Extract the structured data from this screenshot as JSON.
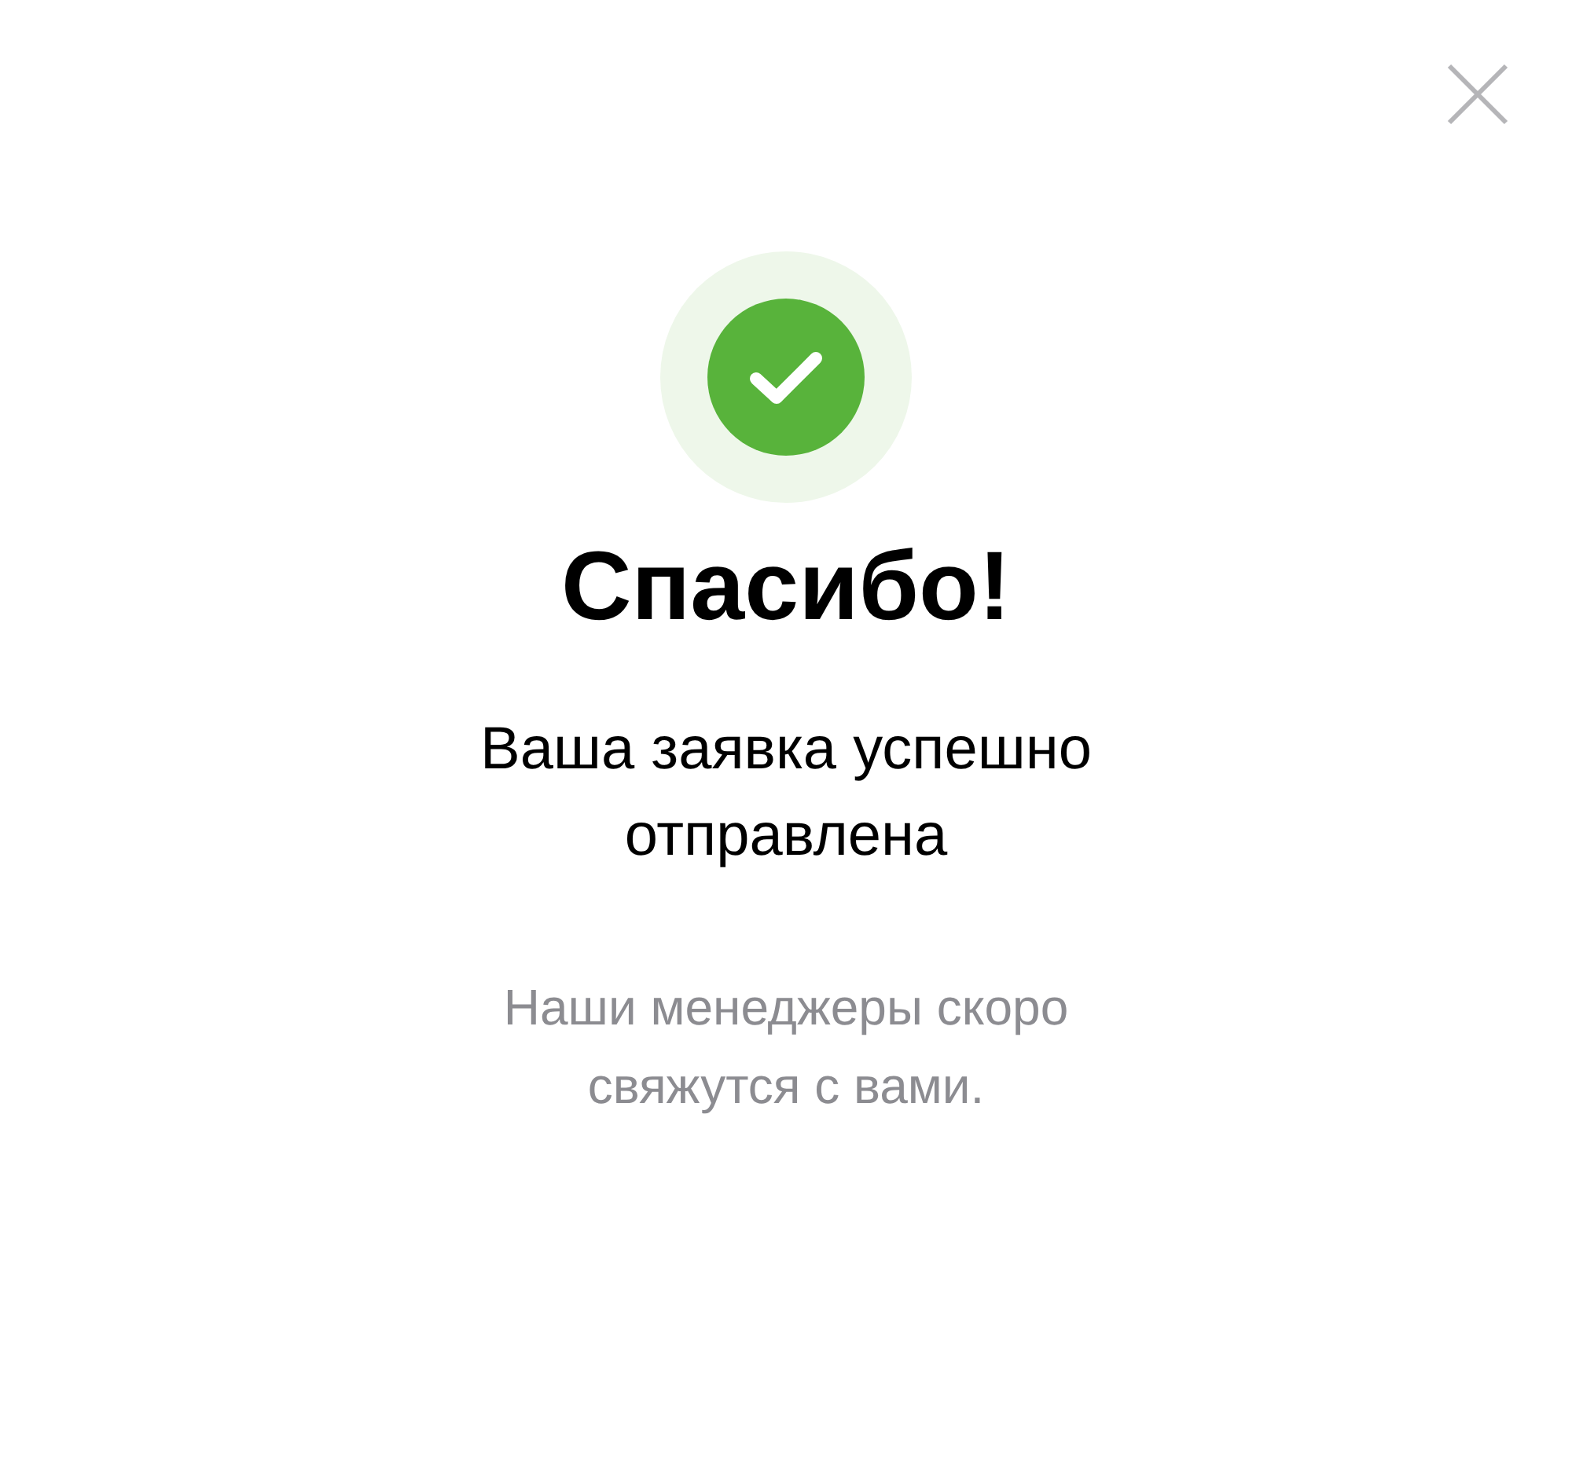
{
  "title": "Спасибо!",
  "subtitle": "Ваша заявка успешно отправлена",
  "message": "Наши менеджеры скоро свяжутся с вами."
}
